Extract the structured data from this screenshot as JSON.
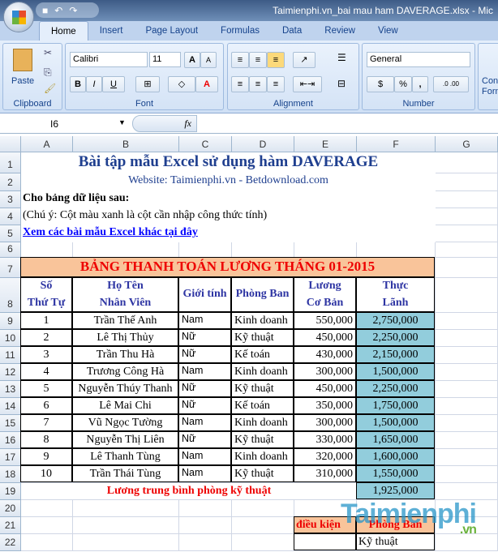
{
  "window": {
    "title": "Taimienphi.vn_bai mau ham DAVERAGE.xlsx - Mic"
  },
  "tabs": [
    "Home",
    "Insert",
    "Page Layout",
    "Formulas",
    "Data",
    "Review",
    "View"
  ],
  "ribbon": {
    "paste": "Paste",
    "clipboard": "Clipboard",
    "font_name": "Calibri",
    "font_size": "11",
    "font": "Font",
    "alignment": "Alignment",
    "number_format": "General",
    "number": "Number",
    "cond": "Con Form",
    "bold": "B",
    "italic": "I",
    "underline": "U",
    "percent": "%",
    "comma": ",",
    "grow": "A",
    "shrink": "A",
    "color_a": "A"
  },
  "formula_bar": {
    "name_box": "I6",
    "fx": "fx",
    "formula": ""
  },
  "columns": [
    "A",
    "B",
    "C",
    "D",
    "E",
    "F",
    "G"
  ],
  "rows": [
    "1",
    "2",
    "3",
    "4",
    "5",
    "6",
    "7",
    "8",
    "9",
    "10",
    "11",
    "12",
    "13",
    "14",
    "15",
    "16",
    "17",
    "18",
    "19",
    "20",
    "21",
    "22"
  ],
  "sheet": {
    "title": "Bài tập mẫu Excel sử dụng hàm DAVERAGE",
    "website": "Website: Taimienphi.vn - Betdownload.com",
    "r3": "Cho bảng dữ liệu sau:",
    "r4": "(Chú ý: Cột màu xanh là cột cần nhập công thức tính)",
    "r5": "Xem các bài mẫu Excel khác tại đây",
    "table_title": "BẢNG THANH TOÁN LƯƠNG THÁNG 01-2015",
    "headers": [
      "Số\nThứ Tự",
      "Họ Tên\nNhân Viên",
      "Giới tính",
      "Phòng Ban",
      "Lương\nCơ Bản",
      "Thực\nLãnh"
    ],
    "records": [
      [
        "1",
        "Trần Thế Anh",
        "Nam",
        "Kinh doanh",
        "550,000",
        "2,750,000"
      ],
      [
        "2",
        "Lê Thị Thủy",
        "Nữ",
        "Kỹ thuật",
        "450,000",
        "2,250,000"
      ],
      [
        "3",
        "Trần Thu Hà",
        "Nữ",
        "Kế toán",
        "430,000",
        "2,150,000"
      ],
      [
        "4",
        "Trương Công Hà",
        "Nam",
        "Kinh doanh",
        "300,000",
        "1,500,000"
      ],
      [
        "5",
        "Nguyễn Thúy Thanh",
        "Nữ",
        "Kỹ thuật",
        "450,000",
        "2,250,000"
      ],
      [
        "6",
        "Lê Mai Chi",
        "Nữ",
        "Kế toán",
        "350,000",
        "1,750,000"
      ],
      [
        "7",
        "Vũ Ngọc Tường",
        "Nam",
        "Kinh doanh",
        "300,000",
        "1,500,000"
      ],
      [
        "8",
        "Nguyễn Thị Liên",
        "Nữ",
        "Kỹ thuật",
        "330,000",
        "1,650,000"
      ],
      [
        "9",
        "Lê Thanh Tùng",
        "Nam",
        "Kinh doanh",
        "320,000",
        "1,600,000"
      ],
      [
        "10",
        "Trần Thái Tùng",
        "Nam",
        "Kỹ thuật",
        "310,000",
        "1,550,000"
      ]
    ],
    "avg_label": "Lương trung bình phòng kỹ thuật",
    "avg_value": "1,925,000",
    "cond_label": "điều kiện",
    "cond_header": "Phòng Ban",
    "cond_value": "Kỹ thuật"
  },
  "watermark": "Taimienphi",
  "colors": {
    "title_blue": "#1f3f8f",
    "red": "#e00000",
    "orange": "#f9c49a",
    "blue_fill": "#92cddc",
    "header_text": "#2e35a3"
  }
}
